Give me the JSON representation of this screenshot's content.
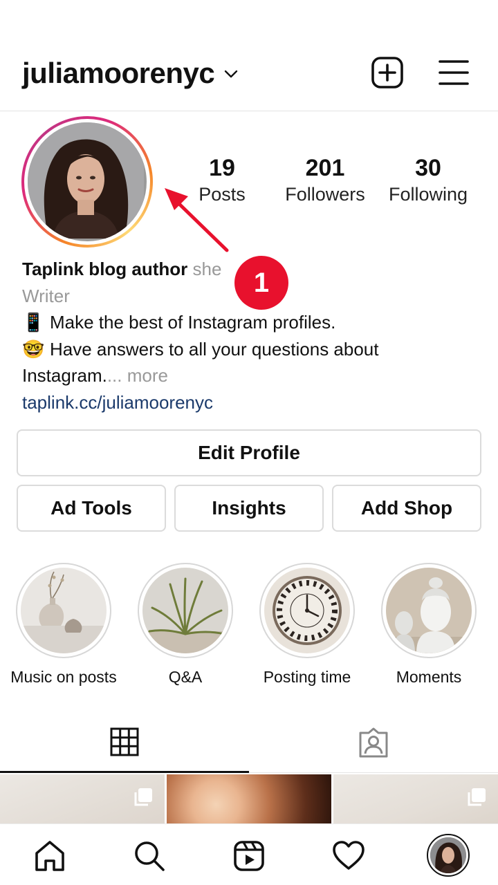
{
  "header": {
    "username": "juliamoorenyc",
    "icons": [
      "chevron-down-icon",
      "new-post-icon",
      "menu-icon"
    ]
  },
  "stats": [
    {
      "value": "19",
      "label": "Posts"
    },
    {
      "value": "201",
      "label": "Followers"
    },
    {
      "value": "30",
      "label": "Following"
    }
  ],
  "annotation": {
    "badge": "1",
    "color": "#e8112d"
  },
  "bio": {
    "name": "Taplink blog author",
    "pronoun": "she",
    "category": "Writer",
    "line1_emoji": "📱",
    "line1": "Make the best of Instagram profiles.",
    "line2_emoji": "🤓",
    "line2": "Have answers to all your questions about",
    "line3": "Instagram.",
    "more": "... more",
    "link": "taplink.cc/juliamoorenyc"
  },
  "buttons": {
    "edit_profile": "Edit Profile",
    "ad_tools": "Ad Tools",
    "insights": "Insights",
    "add_shop": "Add Shop"
  },
  "highlights": [
    {
      "label": "Music on posts",
      "image": "vases"
    },
    {
      "label": "Q&A",
      "image": "air-plant"
    },
    {
      "label": "Posting time",
      "image": "wall-clock"
    },
    {
      "label": "Moments",
      "image": "buddha-statue"
    }
  ],
  "tabs": [
    {
      "icon": "grid-icon",
      "active": true
    },
    {
      "icon": "tagged-icon",
      "active": false
    }
  ],
  "nav": [
    "home-icon",
    "search-icon",
    "reels-icon",
    "heart-icon",
    "profile-avatar"
  ]
}
